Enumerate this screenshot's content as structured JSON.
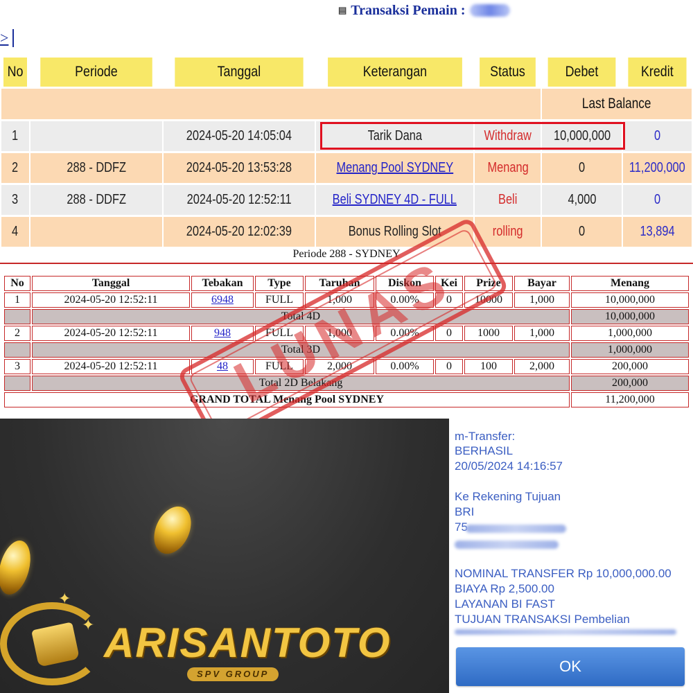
{
  "header": {
    "title": "Transaksi  Pemain :",
    "nav_symbol": ">"
  },
  "transactions": {
    "columns": [
      "No",
      "Periode",
      "Tanggal",
      "Keterangan",
      "Status",
      "Debet",
      "Kredit"
    ],
    "last_balance_label": "Last Balance",
    "rows": [
      {
        "no": "1",
        "periode": "",
        "tanggal": "2024-05-20 14:05:04",
        "keterangan": "Tarik Dana",
        "keterangan_link": false,
        "status": "Withdraw",
        "debet": "10,000,000",
        "kredit": "0"
      },
      {
        "no": "2",
        "periode": "288 - DDFZ",
        "tanggal": "2024-05-20 13:53:28",
        "keterangan": "Menang Pool SYDNEY",
        "keterangan_link": true,
        "status": "Menang",
        "debet": "0",
        "kredit": "11,200,000"
      },
      {
        "no": "3",
        "periode": "288 - DDFZ",
        "tanggal": "2024-05-20 12:52:11",
        "keterangan": "Beli SYDNEY 4D - FULL",
        "keterangan_link": true,
        "status": "Beli",
        "debet": "4,000",
        "kredit": "0"
      },
      {
        "no": "4",
        "periode": "",
        "tanggal": "2024-05-20 12:02:39",
        "keterangan": "Bonus Rolling Slot",
        "keterangan_link": false,
        "status": "rolling",
        "debet": "0",
        "kredit": "13,894"
      }
    ]
  },
  "periode": {
    "title": "Periode 288 - SYDNEY",
    "columns": [
      "No",
      "Tanggal",
      "Tebakan",
      "Type",
      "Taruhan",
      "Diskon",
      "Kei",
      "Prize",
      "Bayar",
      "Menang"
    ],
    "rows": [
      {
        "no": "1",
        "tanggal": "2024-05-20 12:52:11",
        "tebakan": "6948",
        "type": "FULL",
        "taruhan": "1,000",
        "diskon": "0.00%",
        "kei": "0",
        "prize": "10000",
        "bayar": "1,000",
        "menang": "10,000,000"
      },
      {
        "total_label": "Total 4D",
        "total_value": "10,000,000"
      },
      {
        "no": "2",
        "tanggal": "2024-05-20 12:52:11",
        "tebakan": "948",
        "type": "FULL",
        "taruhan": "1,000",
        "diskon": "0.00%",
        "kei": "0",
        "prize": "1000",
        "bayar": "1,000",
        "menang": "1,000,000"
      },
      {
        "total_label": "Total 3D",
        "total_value": "1,000,000"
      },
      {
        "no": "3",
        "tanggal": "2024-05-20 12:52:11",
        "tebakan": "48",
        "type": "FULL",
        "taruhan": "2,000",
        "diskon": "0.00%",
        "kei": "0",
        "prize": "100",
        "bayar": "2,000",
        "menang": "200,000"
      },
      {
        "total_label": "Total 2D Belakang",
        "total_value": "200,000"
      }
    ],
    "grand_total_label": "GRAND TOTAL  Menang Pool SYDNEY",
    "grand_total_value": "11,200,000",
    "stamp_text": "LUNAS"
  },
  "logo": {
    "brand": "ARISANTOTO",
    "sub": "SPV GROUP"
  },
  "receipt": {
    "lines": [
      "m-Transfer:",
      "BERHASIL",
      "20/05/2024 14:16:57",
      "",
      "Ke Rekening Tujuan",
      "BRI",
      "75",
      "",
      "",
      "NOMINAL TRANSFER Rp 10,000,000.00",
      "BIAYA Rp 2,500.00",
      "LAYANAN BI FAST",
      "TUJUAN TRANSAKSI Pembelian"
    ],
    "ok_label": "OK"
  },
  "colors": {
    "header_yellow": "#f8e868",
    "row_orange": "#fcd9b3",
    "row_gray": "#ececec",
    "highlight_red": "#e01020",
    "link_blue": "#2323c8",
    "receipt_blue": "#3b5ec2"
  }
}
